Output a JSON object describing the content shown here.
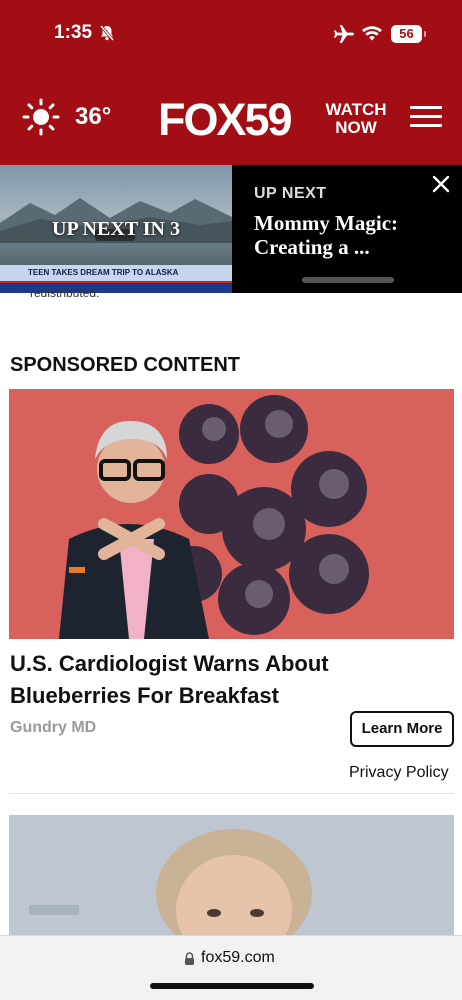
{
  "status_bar": {
    "time": "1:35",
    "battery": "56"
  },
  "header": {
    "temperature": "36°",
    "logo": "FOX59",
    "watch_now_line1": "WATCH",
    "watch_now_line2": "NOW"
  },
  "video_player": {
    "countdown_label": "UP NEXT IN 3",
    "ticker_text": "TEEN TAKES DREAM TRIP TO ALASKA",
    "up_next_label": "UP NEXT",
    "next_title": "Mommy Magic: Creating a ..."
  },
  "article_fragment": "redistributed.",
  "sponsored": {
    "section_title": "SPONSORED CONTENT",
    "items": [
      {
        "headline": "U.S. Cardiologist Warns About Blueberries For Breakfast",
        "source": "Gundry MD",
        "cta": "Learn More",
        "privacy": "Privacy Policy"
      }
    ]
  },
  "browser": {
    "url": "fox59.com"
  }
}
